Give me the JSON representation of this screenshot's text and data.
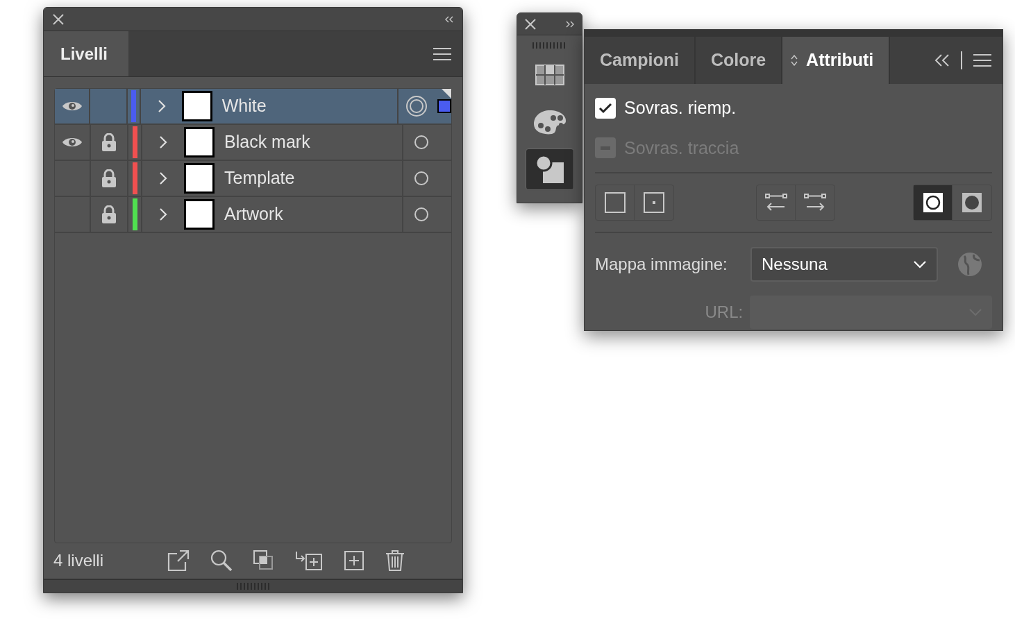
{
  "layers_panel": {
    "tab": "Livelli",
    "layers": [
      {
        "name": "White",
        "visible": true,
        "locked": false,
        "color": "#4a5cf0",
        "selected": true
      },
      {
        "name": "Black mark",
        "visible": true,
        "locked": true,
        "color": "#f05050",
        "selected": false
      },
      {
        "name": "Template",
        "visible": false,
        "locked": true,
        "color": "#f05050",
        "selected": false
      },
      {
        "name": "Artwork",
        "visible": false,
        "locked": true,
        "color": "#50e050",
        "selected": false
      }
    ],
    "count": "4 livelli"
  },
  "dock": {
    "items": [
      {
        "kind": "swatches",
        "selected": false
      },
      {
        "kind": "palette",
        "selected": false
      },
      {
        "kind": "attributes",
        "selected": true
      }
    ]
  },
  "attributes_panel": {
    "tabs": [
      {
        "label": "Campioni",
        "selected": false
      },
      {
        "label": "Colore",
        "selected": false
      },
      {
        "label": "Attributi",
        "selected": true
      }
    ],
    "options": [
      {
        "label": "Sovras. riemp.",
        "checked": true,
        "disabled": false
      },
      {
        "label": "Sovras. traccia",
        "checked": false,
        "disabled": true
      }
    ],
    "fill_rule_buttons": [
      {
        "selected": true
      },
      {
        "selected": false
      }
    ],
    "image_map": {
      "label": "Mappa immagine:",
      "value": "Nessuna"
    },
    "url": {
      "label": "URL:",
      "disabled": true
    }
  }
}
